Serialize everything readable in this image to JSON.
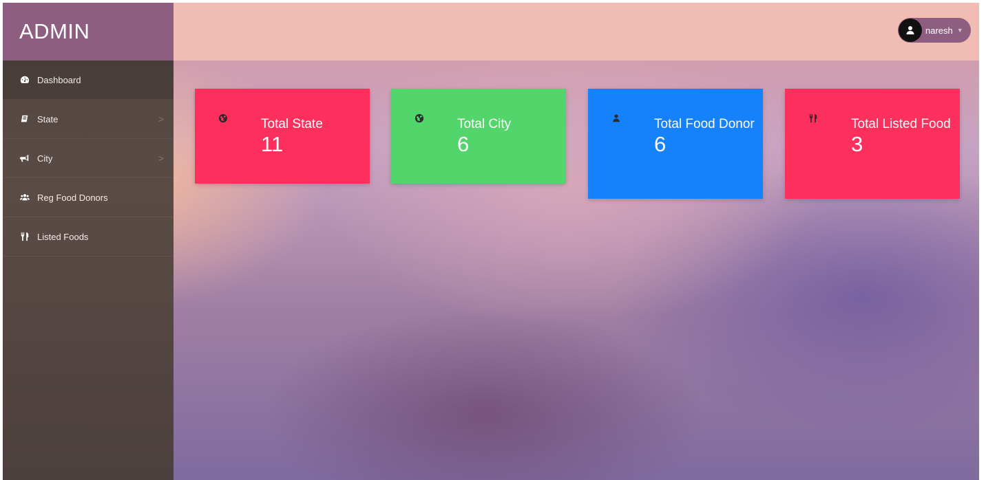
{
  "brand": {
    "title": "ADMIN"
  },
  "sidebar": {
    "items": [
      {
        "label": "Dashboard",
        "icon": "dashboard-icon"
      },
      {
        "label": "State",
        "icon": "book-icon"
      },
      {
        "label": "City",
        "icon": "bullhorn-icon"
      },
      {
        "label": "Reg Food Donors",
        "icon": "users-icon"
      },
      {
        "label": "Listed Foods",
        "icon": "cutlery-icon"
      }
    ],
    "chevron": ">"
  },
  "header": {
    "user": {
      "name": "naresh",
      "caret": "▼"
    }
  },
  "cards": [
    {
      "title": "Total State",
      "value": "11",
      "icon": "globe-icon",
      "color": "#fc2f5d"
    },
    {
      "title": "Total City",
      "value": "6",
      "icon": "globe-icon",
      "color": "#52d56a"
    },
    {
      "title": "Total Food Donor",
      "value": "6",
      "icon": "user-icon",
      "color": "#1581fb"
    },
    {
      "title": "Total Listed Food",
      "value": "3",
      "icon": "cutlery-icon",
      "color": "#fc2f5d"
    }
  ],
  "colors": {
    "brand": "#8d5e80",
    "header": "#f0bcb3",
    "sidebar": "#564a45"
  }
}
